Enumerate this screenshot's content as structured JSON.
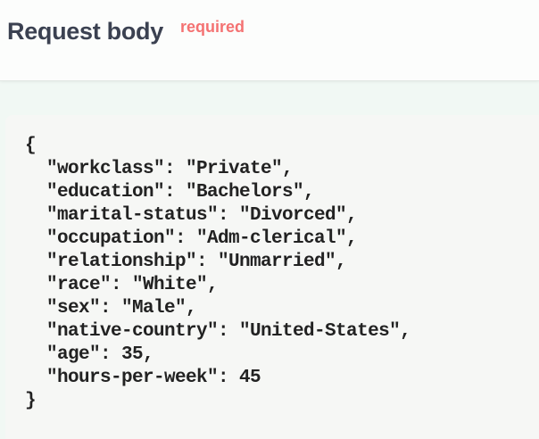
{
  "header": {
    "title": "Request body",
    "required_label": "required"
  },
  "request_body": {
    "json_text": "{\n  \"workclass\": \"Private\",\n  \"education\": \"Bachelors\",\n  \"marital-status\": \"Divorced\",\n  \"occupation\": \"Adm-clerical\",\n  \"relationship\": \"Unmarried\",\n  \"race\": \"White\",\n  \"sex\": \"Male\",\n  \"native-country\": \"United-States\",\n  \"age\": 35,\n  \"hours-per-week\": 45\n}"
  },
  "colors": {
    "required": "#f47272",
    "title": "#3b4151",
    "page_background": "#f1f8f4",
    "code_background": "#f6f7f5"
  }
}
